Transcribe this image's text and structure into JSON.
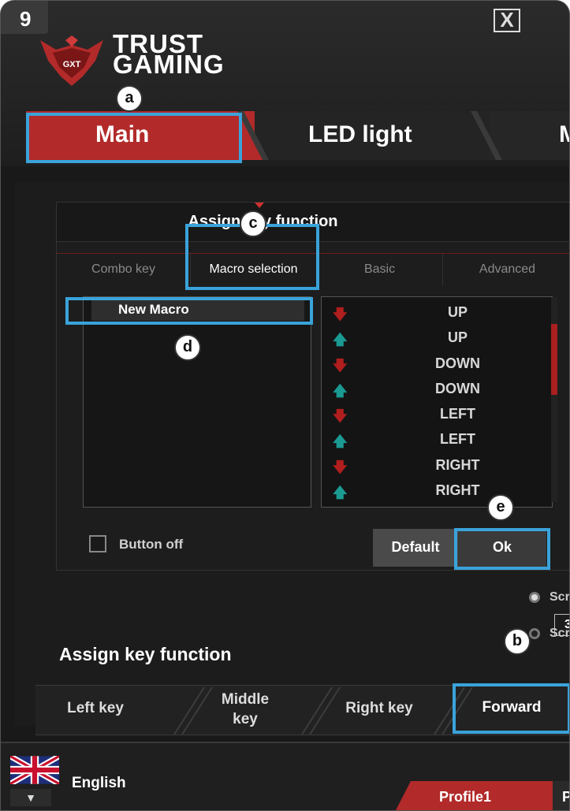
{
  "step_badge": "9",
  "brand": {
    "line1": "TRUST",
    "line2": "GAMING",
    "logo_text": "GXT"
  },
  "main_tabs": [
    {
      "label": "Main"
    },
    {
      "label": "LED light"
    },
    {
      "label": "M"
    }
  ],
  "callouts": {
    "a": "a",
    "b": "b",
    "c": "c",
    "d": "d",
    "e": "e"
  },
  "dialog": {
    "title": "Assign key function",
    "close_icon": "X",
    "tabs": [
      "Combo key",
      "Macro selection",
      "Basic",
      "Advanced"
    ],
    "active_tab": "Macro selection",
    "macros": [
      "New Macro"
    ],
    "steps": [
      {
        "dir": "down",
        "key": "UP"
      },
      {
        "dir": "up",
        "key": "UP"
      },
      {
        "dir": "down",
        "key": "DOWN"
      },
      {
        "dir": "up",
        "key": "DOWN"
      },
      {
        "dir": "down",
        "key": "LEFT"
      },
      {
        "dir": "up",
        "key": "LEFT"
      },
      {
        "dir": "down",
        "key": "RIGHT"
      },
      {
        "dir": "up",
        "key": "RIGHT"
      }
    ],
    "button_off_label": "Button off",
    "default_label": "Default",
    "ok_label": "Ok"
  },
  "scroll": {
    "label1": "Scr",
    "label2": "Scr",
    "value": "3"
  },
  "assign_title": "Assign key function",
  "keys": {
    "left": "Left key",
    "middle_line1": "Middle",
    "middle_line2": "key",
    "right": "Right key",
    "forward": "Forward"
  },
  "footer": {
    "language": "English",
    "profile1": "Profile1",
    "profile2": "P"
  },
  "colors": {
    "accent_red": "#b22a2a",
    "highlight_blue": "#3aa3da",
    "arrow_down": "#b01e1e",
    "arrow_up": "#1a9a92"
  }
}
